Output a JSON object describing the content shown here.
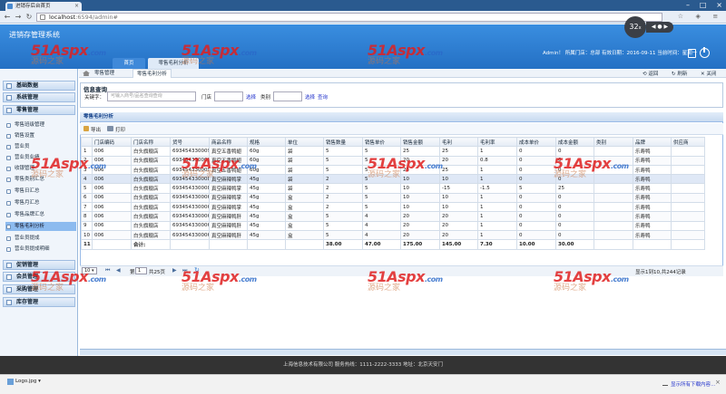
{
  "browser": {
    "tab_title": "进销存后台首页",
    "url_host": "localhost",
    "url_rest": ":6594/admin#",
    "zoom_level": "32",
    "window_controls": [
      "–",
      "□",
      "×"
    ]
  },
  "header": {
    "app_title": "进销存管理系统",
    "user_info": "Admin！ 所属门店：总部 有效日期：2016-09-11  当前时间：星期一",
    "tabs": [
      {
        "label": "首页"
      },
      {
        "label": "零售毛利分析"
      }
    ]
  },
  "sidebar": {
    "groups": [
      {
        "label": "基础数据"
      },
      {
        "label": "系统管理"
      },
      {
        "label": "零售管理"
      },
      {
        "label": "促销管理"
      },
      {
        "label": "会员管理"
      },
      {
        "label": "采购管理"
      },
      {
        "label": "库存管理"
      }
    ],
    "retail_items": [
      {
        "label": "零售班级管理"
      },
      {
        "label": "销售设置"
      },
      {
        "label": "营业员"
      },
      {
        "label": "营业员业绩"
      },
      {
        "label": "收银管理"
      },
      {
        "label": "零售类别汇总"
      },
      {
        "label": "零售日汇总"
      },
      {
        "label": "零售月汇总"
      },
      {
        "label": "零售品牌汇总"
      },
      {
        "label": "零售毛利分析"
      },
      {
        "label": "营业员提成"
      },
      {
        "label": "营业员提成明细"
      }
    ]
  },
  "breadcrumb": {
    "items": [
      "零售管理",
      "零售毛利分析"
    ],
    "right_actions": [
      "返回",
      "刷新",
      "关闭"
    ]
  },
  "query": {
    "title": "信息查询",
    "keyword_label": "关键字：",
    "keyword_placeholder": "可输入商号/品名查询查询",
    "store_label": "门店",
    "select_label": "选择",
    "category_label": "类别",
    "search_label": "查询"
  },
  "grid": {
    "title": "零售毛利分析",
    "export_label": "导出",
    "print_label": "打印",
    "columns": [
      "门店编码",
      "门店名称",
      "货号",
      "商品名称",
      "规格",
      "单位",
      "销售数量",
      "销售单价",
      "销售金额",
      "毛利",
      "毛利率",
      "成本单价",
      "成本金额",
      "类别",
      "品牌",
      "供应商"
    ],
    "rows": [
      [
        "1",
        "006",
        "白头旗舰店",
        "6934543300096",
        "真空五香鸭翅",
        "60g",
        "袋",
        "5",
        "5",
        "25",
        "25",
        "1",
        "0",
        "0",
        "",
        "乐寿鸭",
        ""
      ],
      [
        "2",
        "006",
        "白头旗舰店",
        "6934543300096",
        "真空五香鸭翅",
        "60g",
        "袋",
        "5",
        "5",
        "20",
        "20",
        "0.8",
        "0",
        "0",
        "",
        "乐寿鸭",
        ""
      ],
      [
        "3",
        "006",
        "白头旗舰店",
        "6934543300096",
        "真空五香鸭翅",
        "60g",
        "袋",
        "5",
        "5",
        "25",
        "25",
        "1",
        "0",
        "0",
        "",
        "乐寿鸭",
        ""
      ],
      [
        "4",
        "006",
        "白头旗舰店",
        "6934543300089",
        "真空麻辣鸭掌",
        "45g",
        "袋",
        "2",
        "5",
        "10",
        "10",
        "1",
        "0",
        "0",
        "",
        "乐寿鸭",
        ""
      ],
      [
        "5",
        "006",
        "白头旗舰店",
        "6934543300089",
        "真空麻辣鸭掌",
        "45g",
        "袋",
        "2",
        "5",
        "10",
        "-15",
        "-1.5",
        "5",
        "25",
        "",
        "乐寿鸭",
        ""
      ],
      [
        "6",
        "006",
        "白头旗舰店",
        "6934543300065",
        "真空麻辣鸭掌",
        "45g",
        "盒",
        "2",
        "5",
        "10",
        "10",
        "1",
        "0",
        "0",
        "",
        "乐寿鸭",
        ""
      ],
      [
        "7",
        "006",
        "白头旗舰店",
        "6934543300065",
        "真空麻辣鸭掌",
        "45g",
        "盒",
        "2",
        "5",
        "10",
        "10",
        "1",
        "0",
        "0",
        "",
        "乐寿鸭",
        ""
      ],
      [
        "8",
        "006",
        "白头旗舰店",
        "6934543300065",
        "真空麻辣鸭肝",
        "45g",
        "盒",
        "5",
        "4",
        "20",
        "20",
        "1",
        "0",
        "0",
        "",
        "乐寿鸭",
        ""
      ],
      [
        "9",
        "006",
        "白头旗舰店",
        "6934543300065",
        "真空麻辣鸭肝",
        "45g",
        "盒",
        "5",
        "4",
        "20",
        "20",
        "1",
        "0",
        "0",
        "",
        "乐寿鸭",
        ""
      ],
      [
        "10",
        "006",
        "白头旗舰店",
        "6934543300065",
        "真空麻辣鸭肝",
        "45g",
        "盒",
        "5",
        "4",
        "20",
        "20",
        "1",
        "0",
        "0",
        "",
        "乐寿鸭",
        ""
      ]
    ],
    "summary": [
      "11",
      "",
      "合计:",
      "",
      "",
      "",
      "",
      "38.00",
      "47.00",
      "175.00",
      "145.00",
      "7.30",
      "10.00",
      "30.00",
      "",
      "",
      ""
    ]
  },
  "pager": {
    "page_size": "10",
    "page_label": "第",
    "page_value": "1",
    "total_pages": "共25页",
    "status": "显示1到10,共244记录"
  },
  "footer": {
    "text": "上海信息技术有限公司  服务热线：1111-2222-3333  地址：北京天安门"
  },
  "download_bar": {
    "file_name": "Logo.jpg",
    "show_all": "显示所有下载内容..."
  },
  "watermark": {
    "main": "51Aspx",
    "suffix": ".com",
    "sub": "源码之家"
  }
}
